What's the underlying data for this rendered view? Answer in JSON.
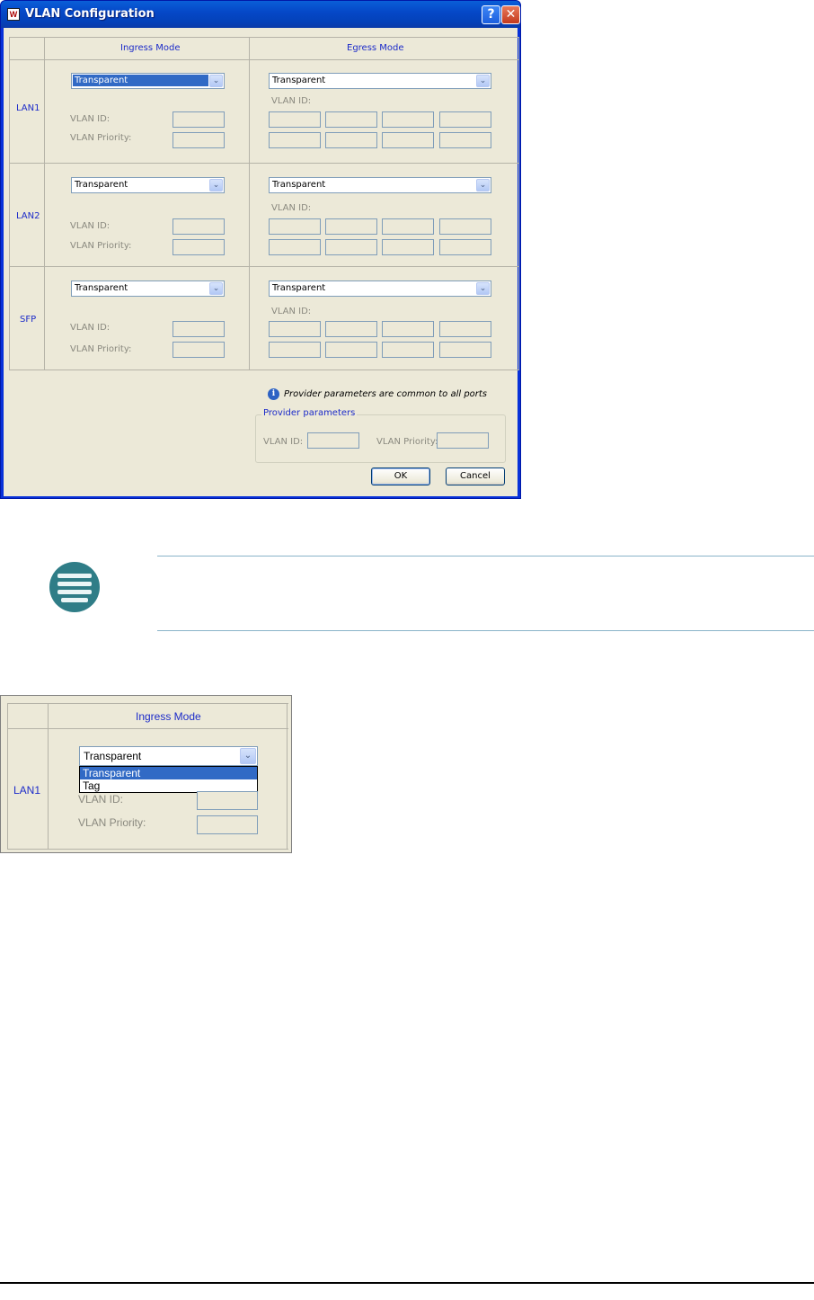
{
  "dialog": {
    "title": "VLAN Configuration",
    "app_icon": "W",
    "help_label": "?",
    "close_label": "✕",
    "headers": {
      "ingress": "Ingress Mode",
      "egress": "Egress Mode"
    },
    "ports": [
      {
        "name": "LAN1",
        "ingress_mode": "Transparent",
        "egress_mode": "Transparent"
      },
      {
        "name": "LAN2",
        "ingress_mode": "Transparent",
        "egress_mode": "Transparent"
      },
      {
        "name": "SFP",
        "ingress_mode": "Transparent",
        "egress_mode": "Transparent"
      }
    ],
    "labels": {
      "vlan_id": "VLAN ID:",
      "vlan_priority": "VLAN Priority:"
    },
    "info_text": "Provider parameters are common to all ports",
    "provider": {
      "legend": "Provider parameters",
      "vlan_id_label": "VLAN ID:",
      "vlan_priority_label": "VLAN Priority:"
    },
    "ok_label": "OK",
    "cancel_label": "Cancel"
  },
  "crop": {
    "header": "Ingress Mode",
    "port": "LAN1",
    "selected": "Transparent",
    "options": [
      "Transparent",
      "Tag"
    ],
    "vlan_id_label": "VLAN ID:",
    "vlan_priority_label": "VLAN Priority:"
  },
  "colors": {
    "titlebar": "#0548c8",
    "dialog_bg": "#ece9d8",
    "label_blue": "#1c2bc9",
    "selection": "#316ac5",
    "note_icon": "#2f7d87"
  }
}
